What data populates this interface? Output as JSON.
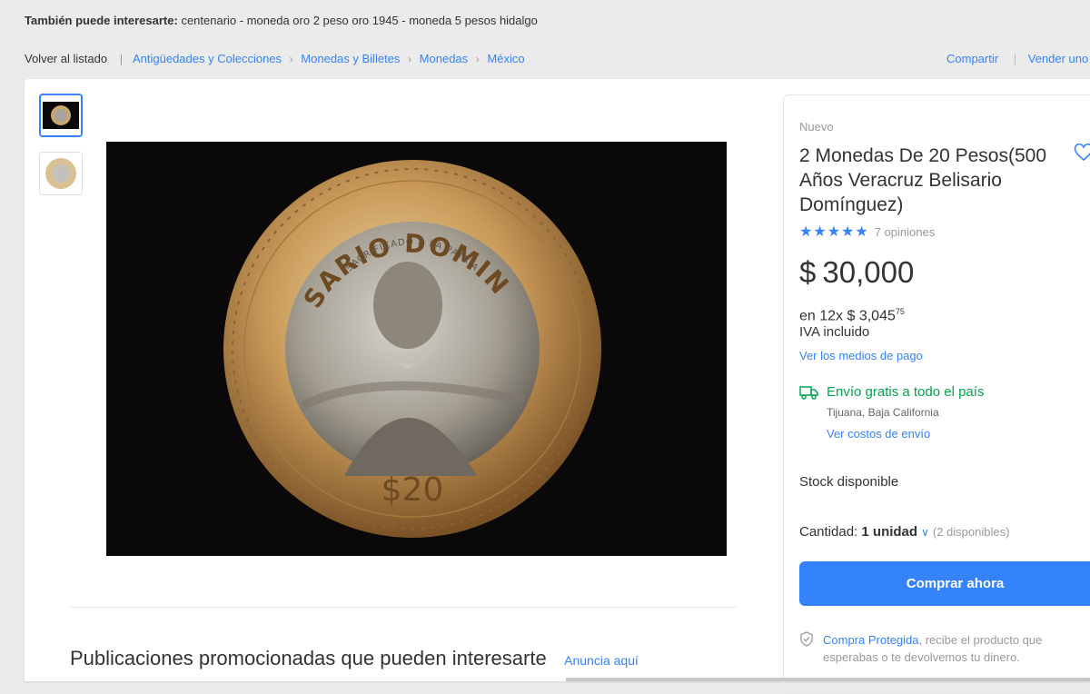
{
  "also_interested": {
    "label": "También puede interesarte:",
    "items": "centenario - moneda oro 2 peso oro 1945 - moneda 5 pesos hidalgo"
  },
  "nav": {
    "back": "Volver al listado",
    "breadcrumb": [
      "Antigüedades y Colecciones",
      "Monedas y Billetes",
      "Monedas",
      "México"
    ],
    "share": "Compartir",
    "sell": "Vender uno igual"
  },
  "product": {
    "condition": "Nuevo",
    "title": "2 Monedas De 20 Pesos(500 Años Veracruz Belisario Domínguez)",
    "rating_stars": "★★★★★",
    "rating": 5,
    "reviews": "7 opiniones",
    "currency": "$",
    "price": "30,000",
    "installments_prefix": "en 12x $ 3,045",
    "installments_cents": "75",
    "iva": "IVA incluido",
    "payment_link": "Ver los medios de pago",
    "shipping": "Envío gratis a todo el país",
    "shipping_location": "Tijuana, Baja California",
    "shipping_link": "Ver costos de envío",
    "stock": "Stock disponible",
    "quantity_label": "Cantidad:",
    "quantity_value": "1 unidad",
    "quantity_available": "(2 disponibles)",
    "buy_button": "Comprar ahora",
    "protected_link": "Compra Protegida",
    "protected_text": ", recibe el producto que esperabas o te devolvemos tu dinero."
  },
  "coin": {
    "top_text": "BELISARIO DOMINGUEZ",
    "sub_text": "SACRIFICADO A LA PATRIA",
    "value": "$20"
  },
  "promoted": {
    "title": "Publicaciones promocionadas que pueden interesarte",
    "link": "Anuncia aquí"
  },
  "colors": {
    "accent": "#3483fa",
    "success": "#00a650",
    "background": "#ebebeb"
  }
}
